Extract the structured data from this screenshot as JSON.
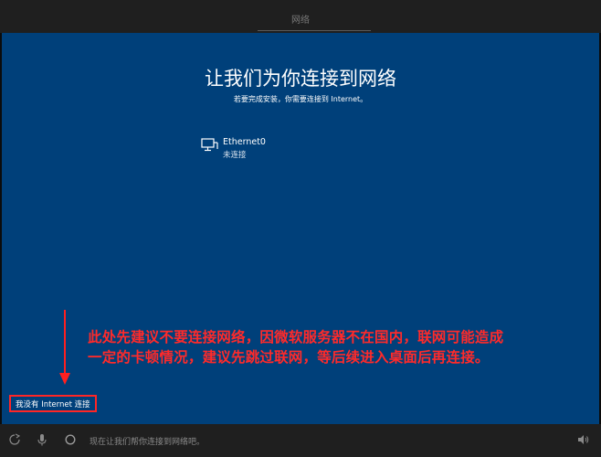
{
  "window": {
    "tab_title": "网络"
  },
  "setup": {
    "heading": "让我们为你连接到网络",
    "subheading": "若要完成安装，你需要连接到 Internet。",
    "networks": [
      {
        "name": "Ethernet0",
        "status": "未连接",
        "icon": "ethernet-icon"
      }
    ],
    "skip_link": "我没有 Internet 连接"
  },
  "annotation": {
    "line1": "此处先建议不要连接网络，因微软服务器不在国内，联网可能造成",
    "line2": "一定的卡顿情况，建议先跳过联网，等后续进入桌面后再连接。",
    "color": "#ff2a2a"
  },
  "taskbar": {
    "icons": [
      "accessibility-icon",
      "microphone-icon",
      "cortana-circle-icon",
      "volume-icon"
    ],
    "assistant_text": "现在让我们帮你连接到网络吧。"
  },
  "colors": {
    "panel": "#00407a",
    "chrome": "#1f1f1f"
  }
}
